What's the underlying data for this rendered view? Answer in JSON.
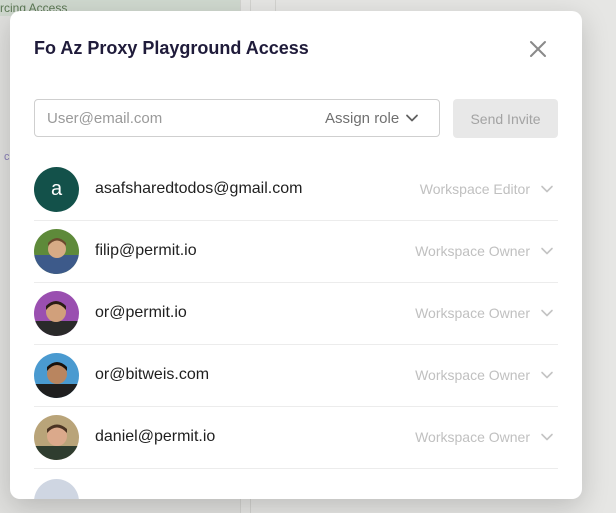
{
  "background": {
    "active_nav_label": "rcing Access",
    "fragment_text": "c"
  },
  "modal": {
    "title": "Fo Az Proxy Playground Access",
    "invite": {
      "email_placeholder": "User@email.com",
      "email_value": "",
      "role_label": "Assign role",
      "send_label": "Send Invite"
    },
    "members": [
      {
        "email": "asafsharedtodos@gmail.com",
        "role": "Workspace Editor",
        "avatar_letter": "a",
        "avatar_type": "letter"
      },
      {
        "email": "filip@permit.io",
        "role": "Workspace Owner",
        "avatar_type": "photo",
        "avatar_colors": [
          "#6a8f3d",
          "#3d5a8a",
          "#d9b08c"
        ]
      },
      {
        "email": "or@permit.io",
        "role": "Workspace Owner",
        "avatar_type": "photo",
        "avatar_colors": [
          "#8a3fa0",
          "#2b2b2b",
          "#d4a07a"
        ]
      },
      {
        "email": "or@bitweis.com",
        "role": "Workspace Owner",
        "avatar_type": "photo",
        "avatar_colors": [
          "#3a8fc7",
          "#1d1d1d",
          "#b98560"
        ]
      },
      {
        "email": "daniel@permit.io",
        "role": "Workspace Owner",
        "avatar_type": "photo",
        "avatar_colors": [
          "#b8a070",
          "#2f3d2f",
          "#d9a58a"
        ]
      }
    ]
  },
  "colors": {
    "avatar_letter_bg": "#13514a",
    "title": "#1f1b3a",
    "send_disabled_bg": "#e8e8e8"
  }
}
